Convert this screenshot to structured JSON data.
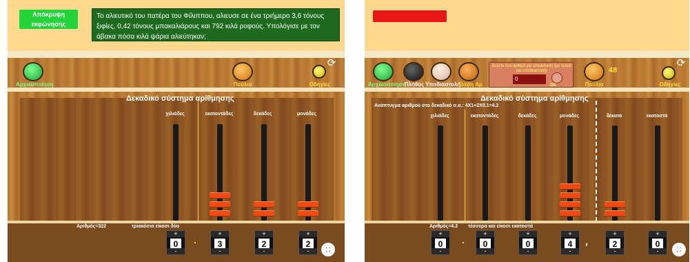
{
  "left": {
    "hide_narration_label": "Απόκρυψη εκφώνησης",
    "question_text": "Το αλιευτικό του πατέρα του Φίλιππου, αλιευσε σε ένα τριήμερο 3,6 τόνους ξιφίες, 0,42 τόνους μπακαλιάρους και 792 κιλά ροφούς. Υπολόγισε με τον άβακα πόσα κιλά ψάρια αλιεύτηκαν;",
    "start_label": "Αρχικοποίηση",
    "pool_label": "Πούλια",
    "instructions_label": "Οδηγίες",
    "system_title": "Δεκαδικό σύστημα αρίθμησης",
    "columns": [
      "χιλιάδες",
      "εκατοντάδες",
      "δεκάδες",
      "μονάδες"
    ],
    "number_readout": "Αριθμός=322",
    "number_words": "τριακόσια είκοσι δύο",
    "wheels": [
      "0",
      "3",
      "2",
      "2"
    ],
    "beads": [
      0,
      3,
      2,
      2
    ]
  },
  "right": {
    "start_label": "Αρχικοποίηση",
    "count_label": "Πλήθος",
    "subtraction_label": "Υποδιαστολή",
    "base_label": "Βάση Αρ",
    "prompt_text": "Δώστε ένα αριθμό για απεικόνιση (με τελεία για υποδιαστολή)",
    "prompt_value": "0",
    "ok_label": "OK",
    "pool_count": "48",
    "pool_label": "Πούλια",
    "instructions_label": "Οδηγίες",
    "system_title": "Δεκαδικό σύστημα αρίθμησης",
    "expansion_label": "Ανάπτυγμα αριθμού στο δεκαδικό σ.α.: 4X1+2X0.1=4.2",
    "columns": [
      "χιλιάδες",
      "εκατοντάδες",
      "δεκάδες",
      "μονάδες",
      "δέκατα",
      "εκατοστά"
    ],
    "number_readout": "Αριθμός=4.2",
    "number_words": "τέσσερα και είκοσι εκατοστά",
    "wheels": [
      "0",
      "0",
      "0",
      "4",
      "2",
      "0"
    ],
    "beads": [
      0,
      0,
      0,
      4,
      2,
      0
    ]
  },
  "colors": {
    "banner": "#fdd98f",
    "question_bg": "#1e6a1e",
    "bead": "#ef4a14",
    "green_button": "#22d33a",
    "red_bar": "#e81818"
  }
}
